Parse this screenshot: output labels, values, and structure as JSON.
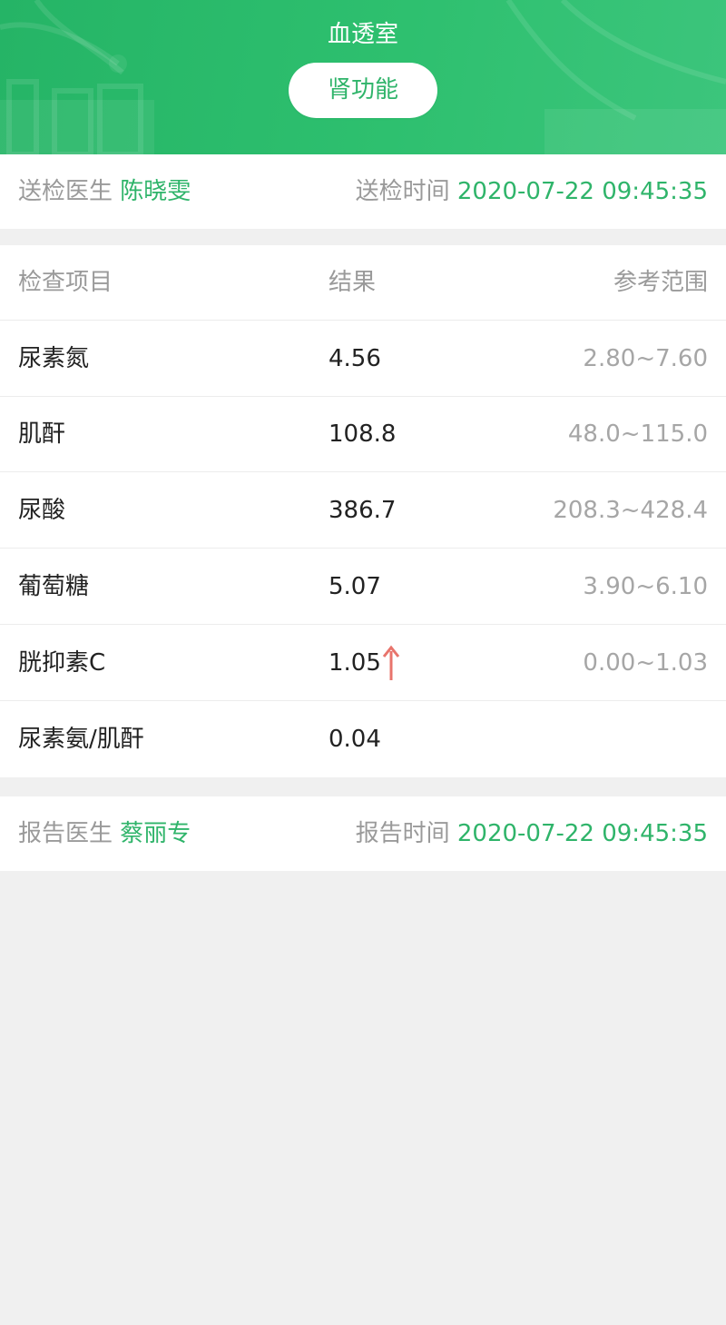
{
  "header": {
    "title": "血透室",
    "category": "肾功能",
    "accent_color": "#2fb46a"
  },
  "submit_info": {
    "doctor_label": "送检医生",
    "doctor_name": "陈晓雯",
    "time_label": "送检时间",
    "time_value": "2020-07-22 09:45:35"
  },
  "table": {
    "columns": [
      "检查项目",
      "结果",
      "参考范围"
    ],
    "rows": [
      {
        "item": "尿素氮",
        "result": "4.56",
        "range": "2.80~7.60",
        "flag": null
      },
      {
        "item": "肌酐",
        "result": "108.8",
        "range": "48.0~115.0",
        "flag": null
      },
      {
        "item": "尿酸",
        "result": "386.7",
        "range": "208.3~428.4",
        "flag": null
      },
      {
        "item": "葡萄糖",
        "result": "5.07",
        "range": "3.90~6.10",
        "flag": null
      },
      {
        "item": "胱抑素C",
        "result": "1.05",
        "range": "0.00~1.03",
        "flag": "arrow-up-icon"
      },
      {
        "item": "尿素氨/肌酐",
        "result": "0.04",
        "range": "",
        "flag": null
      }
    ]
  },
  "report_info": {
    "doctor_label": "报告医生",
    "doctor_name": "蔡丽专",
    "time_label": "报告时间",
    "time_value": "2020-07-22 09:45:35"
  },
  "colors": {
    "header_green": "#2ec06f",
    "high_flag": "#e8746c",
    "page_background": "#f0f0f0"
  }
}
